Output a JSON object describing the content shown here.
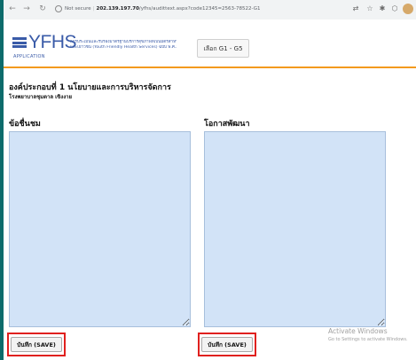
{
  "browser": {
    "back": "←",
    "forward": "→",
    "reload": "↻",
    "security": "Not secure",
    "host": "202.139.197.70",
    "path": "/yfhs/audittext.aspx?code12345=2563-78522-G1",
    "icons": [
      "translate-icon",
      "star-icon",
      "extension-icon",
      "profile-icon"
    ]
  },
  "header": {
    "logo": "YFHS",
    "logo_sub": "APPLICATION",
    "tagline": [
      "การประเมินและรับรองมาตรฐานบริการสุขภาพที่เป็นมิตรสำหรับวัยรุ่น",
      "และเยาวชน (Youth Friendly Health Services) ฉบับ พ.ศ.2563"
    ],
    "select_button": "เลือก G1 - G5",
    "accent_color": "#f39a1e",
    "brand_color": "#3a5ba8"
  },
  "section": {
    "title": "องค์ประกอบที่ 1 นโยบายและการบริหารจัดการ",
    "subtitle": "โรงพยาบาลชุมตาล เขิงงาย"
  },
  "form": {
    "strengths_label": "ข้อชื่นชม",
    "strengths_value": "",
    "improvement_label": "โอกาสพัฒนา",
    "improvement_value": "",
    "save_label": "บันทึก (SAVE)",
    "highlight_color": "#e0201e"
  },
  "watermark": {
    "line1": "Activate Windows",
    "line2": "Go to Settings to activate Windows."
  }
}
